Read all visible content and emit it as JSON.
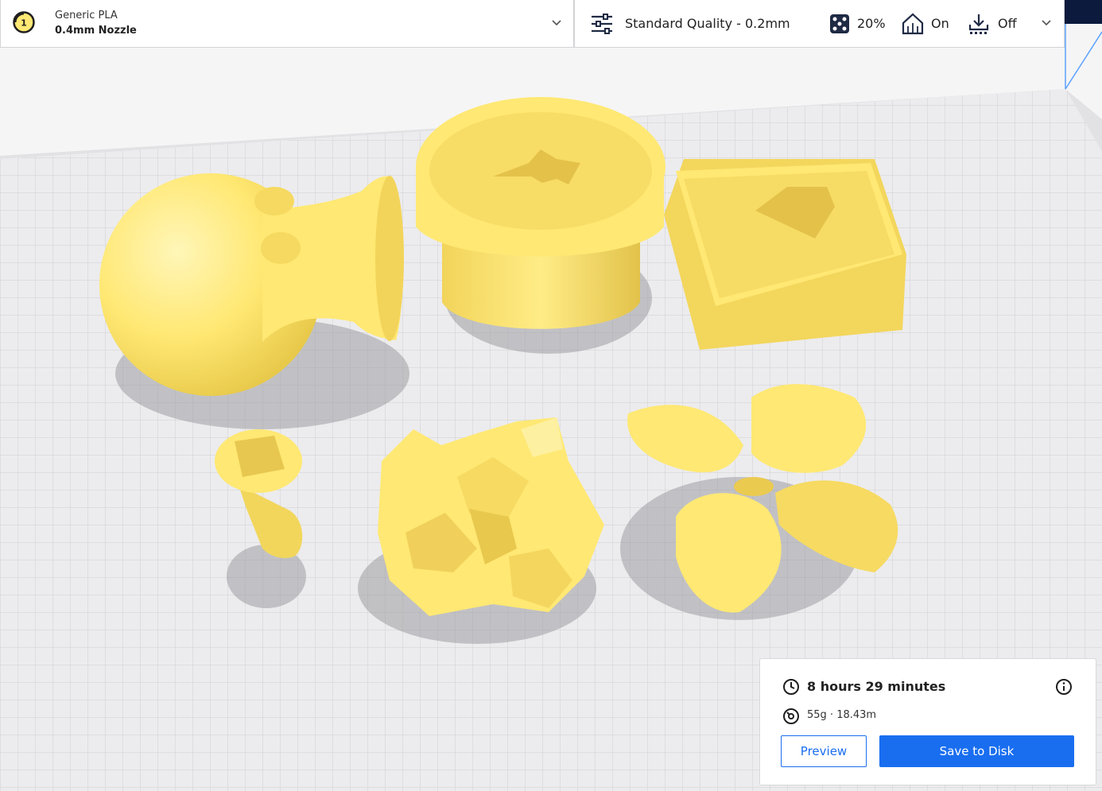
{
  "header": {
    "extruder_number": "1",
    "material_name": "Generic PLA",
    "nozzle": "0.4mm Nozzle",
    "profile": "Standard Quality - 0.2mm",
    "infill": "20%",
    "support": "On",
    "adhesion": "Off",
    "icons": {
      "extruder": "extruder-badge-icon",
      "material_dropdown": "chevron-down-icon",
      "profile": "sliders-icon",
      "infill": "infill-pattern-icon",
      "support": "support-icon",
      "adhesion": "adhesion-icon",
      "print_dropdown": "chevron-down-icon"
    }
  },
  "stats": {
    "time": "8 hours 29 minutes",
    "material": "55g · 18.43m",
    "preview_label": "Preview",
    "save_label": "Save to Disk",
    "icons": {
      "time": "clock-icon",
      "material": "spool-icon",
      "info": "info-icon"
    }
  },
  "colors": {
    "model": "#ffe873",
    "accent": "#196ef0",
    "build_plate": "#ececee",
    "header_background": "#ffffff"
  }
}
